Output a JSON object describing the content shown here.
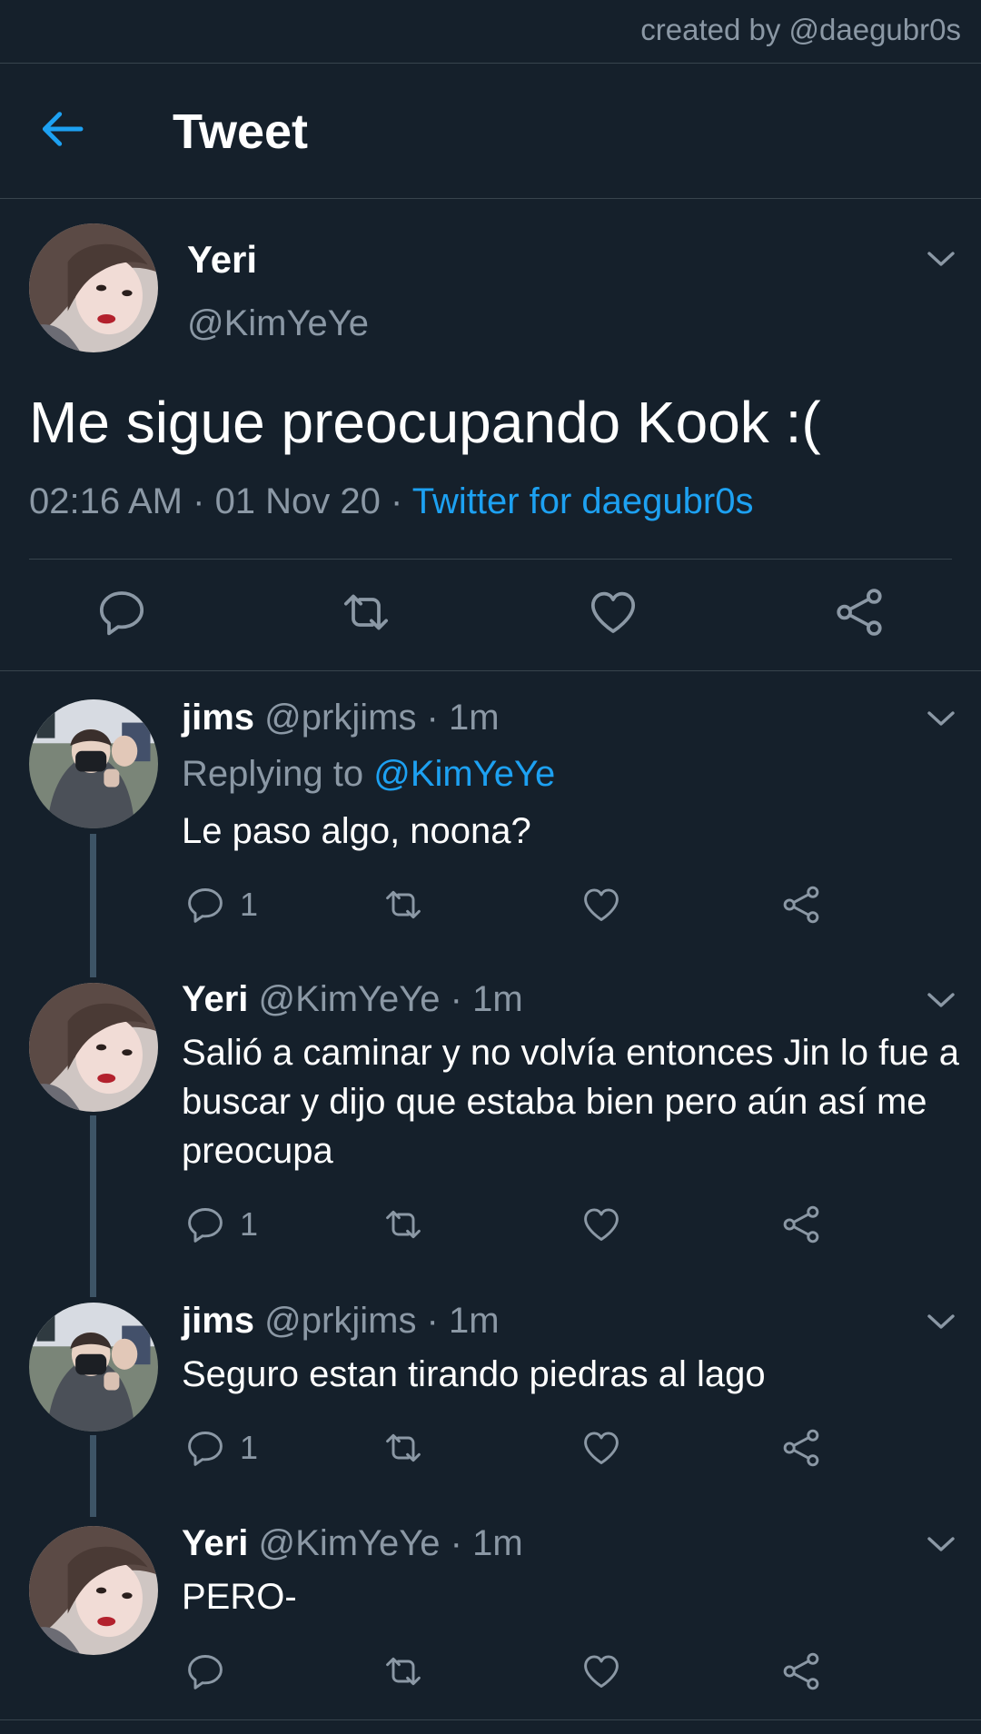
{
  "watermark": "created by @daegubr0s",
  "header": {
    "title": "Tweet"
  },
  "tweet": {
    "name": "Yeri",
    "handle": "@KimYeYe",
    "text": "Me sigue preocupando Kook :(",
    "time": "02:16 AM",
    "date": "01 Nov 20",
    "source": "Twitter for daegubr0s",
    "separator": " · "
  },
  "replies": [
    {
      "name": "jims",
      "handle": "@prkjims",
      "time": "1m",
      "replying_label": "Replying to",
      "replying_to": "@KimYeYe",
      "text": "Le paso algo, noona?",
      "reply_count": "1"
    },
    {
      "name": "Yeri",
      "handle": "@KimYeYe",
      "time": "1m",
      "text": "Salió a caminar y no volvía entonces Jin lo fue a buscar y dijo que estaba bien pero aún así me preocupa",
      "reply_count": "1"
    },
    {
      "name": "jims",
      "handle": "@prkjims",
      "time": "1m",
      "text": "Seguro estan tirando piedras al lago",
      "reply_count": "1"
    },
    {
      "name": "Yeri",
      "handle": "@KimYeYe",
      "time": "1m",
      "text": "PERO-",
      "reply_count": ""
    }
  ],
  "icons": {
    "back": "arrow-left-icon",
    "caret": "chevron-down-icon",
    "reply": "comment-icon",
    "retweet": "retweet-icon",
    "like": "heart-icon",
    "share": "share-icon"
  },
  "colors": {
    "background": "#15202b",
    "accent": "#1da1f2",
    "secondary_text": "#8b98a5",
    "divider": "#38444d",
    "thread_line": "#3d5466"
  }
}
